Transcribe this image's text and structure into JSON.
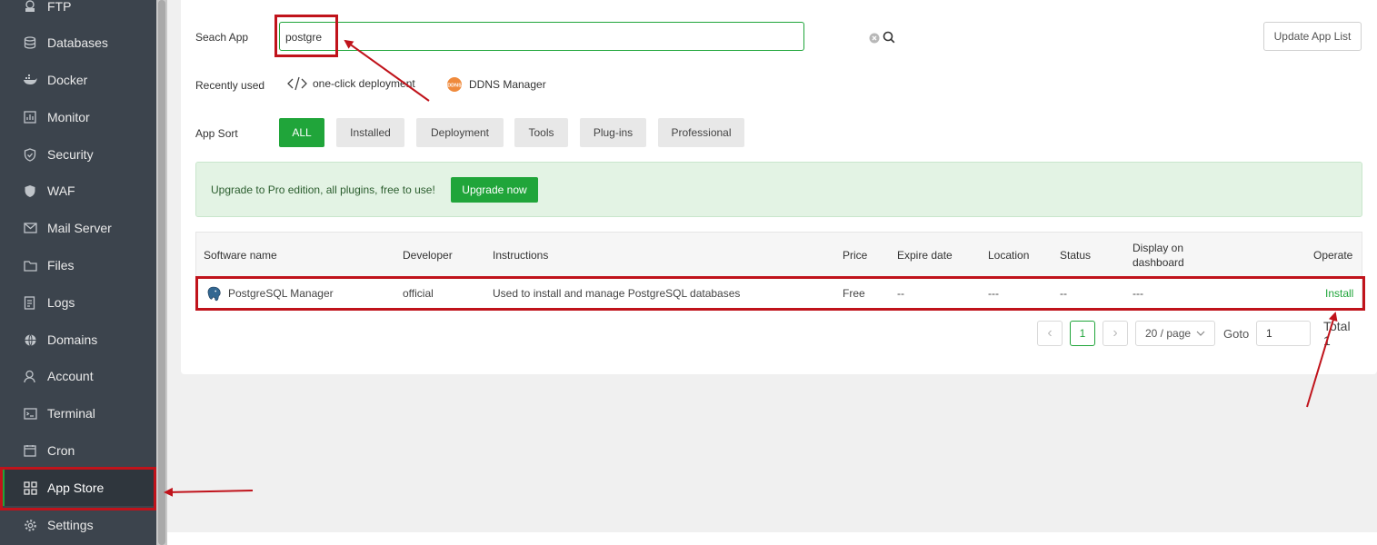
{
  "sidebar": {
    "items": [
      {
        "label": "FTP",
        "icon": "ftp-icon"
      },
      {
        "label": "Databases",
        "icon": "database-icon"
      },
      {
        "label": "Docker",
        "icon": "docker-icon"
      },
      {
        "label": "Monitor",
        "icon": "monitor-icon"
      },
      {
        "label": "Security",
        "icon": "shield-icon"
      },
      {
        "label": "WAF",
        "icon": "waf-shield-icon"
      },
      {
        "label": "Mail Server",
        "icon": "mail-icon"
      },
      {
        "label": "Files",
        "icon": "folder-icon"
      },
      {
        "label": "Logs",
        "icon": "logs-icon"
      },
      {
        "label": "Domains",
        "icon": "globe-icon"
      },
      {
        "label": "Account",
        "icon": "user-icon"
      },
      {
        "label": "Terminal",
        "icon": "terminal-icon"
      },
      {
        "label": "Cron",
        "icon": "calendar-icon"
      },
      {
        "label": "App Store",
        "icon": "app-grid-icon",
        "active": true
      },
      {
        "label": "Settings",
        "icon": "gear-icon"
      }
    ]
  },
  "search": {
    "label": "Seach App",
    "value": "postgre",
    "update_button": "Update App List"
  },
  "recent": {
    "label": "Recently used",
    "items": [
      "one-click deployment",
      "DDNS Manager"
    ]
  },
  "sort": {
    "label": "App Sort",
    "options": [
      "ALL",
      "Installed",
      "Deployment",
      "Tools",
      "Plug-ins",
      "Professional"
    ],
    "active": "ALL"
  },
  "banner": {
    "text": "Upgrade to Pro edition, all plugins, free to use!",
    "button": "Upgrade now"
  },
  "table": {
    "headers": {
      "name": "Software name",
      "developer": "Developer",
      "instructions": "Instructions",
      "price": "Price",
      "expire": "Expire date",
      "location": "Location",
      "status": "Status",
      "display1": "Display on",
      "display2": "dashboard",
      "operate": "Operate"
    },
    "rows": [
      {
        "name": "PostgreSQL Manager",
        "developer": "official",
        "instructions": "Used to install and manage PostgreSQL databases",
        "price": "Free",
        "expire": "--",
        "location": "---",
        "status": "--",
        "display": "---",
        "operate": "Install"
      }
    ]
  },
  "pagination": {
    "prev": "‹",
    "current": "1",
    "next": "›",
    "page_size": "20 / page",
    "goto_label": "Goto",
    "goto_value": "1",
    "total": "Total 1"
  },
  "colors": {
    "accent": "#20a53a",
    "sidebar_bg": "#3c444d",
    "annotation_red": "#c0131b"
  }
}
